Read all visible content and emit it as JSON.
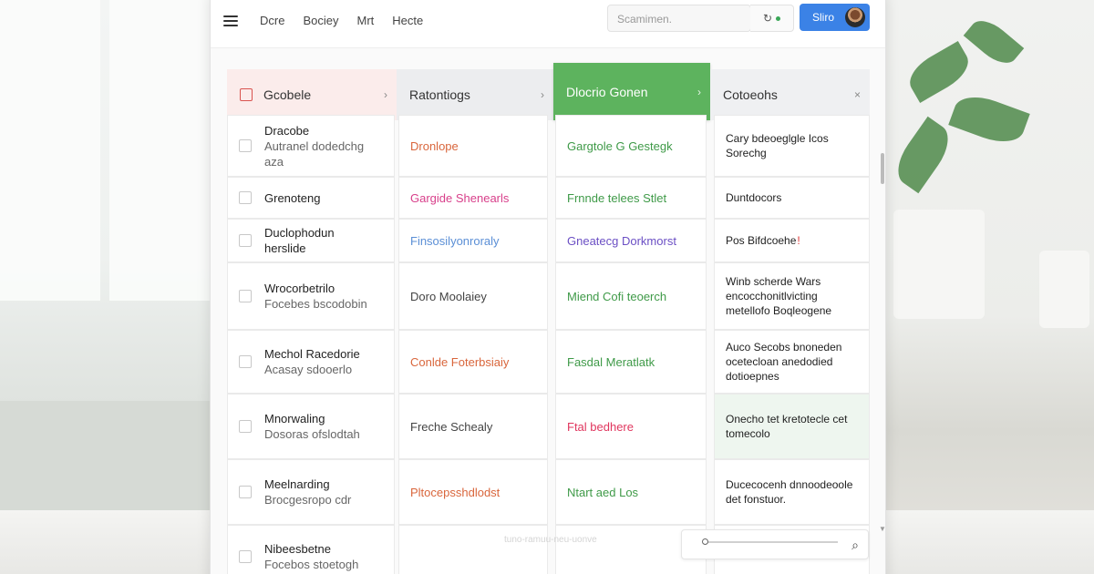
{
  "nav": {
    "items": [
      "Dcre",
      "Bociey",
      "Mrt",
      "Hecte"
    ]
  },
  "search": {
    "placeholder": "Scamimen."
  },
  "profile": {
    "label": "Sliro"
  },
  "board": {
    "columns": [
      {
        "label": "Gcobele",
        "chevron": "›"
      },
      {
        "label": "Ratontiogs",
        "chevron": "›"
      },
      {
        "label": "Dlocrio Gonen",
        "chevron": "›"
      },
      {
        "label": "Cotoeohs",
        "chevron": "×"
      }
    ],
    "rows": [
      {
        "title": "Dracobe",
        "subtitle": "Autranel dodedchg aza",
        "c1": "Dronlope",
        "c2": "Gargtole G Gestegk",
        "c3": "Cary bdeoeglgle Icos Sorechg"
      },
      {
        "title": "Grenoteng",
        "subtitle": "",
        "c1": "Gargide Shenearls",
        "c2": "Frnnde telees Stlet",
        "c3": "Duntdocors"
      },
      {
        "title": "Duclophodun",
        "subtitle": "herslide",
        "c1": "Finsosilyonroraly",
        "c2": "Gneatecg Dorkmorst",
        "c3": "Pos Bifdcoehe"
      },
      {
        "title": "Wrocorbetrilo",
        "subtitle": "Focebes bscodobin",
        "c1": "Doro Moolaiey",
        "c2": "Miend Cofi teoerch",
        "c3": "Winb scherde Wars encocchonitlvicting metellofo Boqleogene"
      },
      {
        "title": "Mechol Racedorie",
        "subtitle": "Acasay sdooerlo",
        "c1": "Conlde Foterbsiaiy",
        "c2": "Fasdal Meratlatk",
        "c3": "Auco Secobs bnoneden ocetecloan anedodied dotioepnes"
      },
      {
        "title": "Mnorwaling",
        "subtitle": "Dosoras ofslodtah",
        "c1": "Freche Schealy",
        "c2": "Ftal bedhere",
        "c3": "Onecho tet kretotecle cet tomecolo"
      },
      {
        "title": "Meelnarding",
        "subtitle": "Brocgesropo cdr",
        "c1": "Pltocepsshdlodst",
        "c2": "Ntart aed Los",
        "c3": "Ducecocenh dnnoodeoole det fonstuor."
      },
      {
        "title": "Nibeesbetne",
        "subtitle": "Focebos stoetogh",
        "c1": "",
        "c2": "",
        "c3": ""
      }
    ]
  },
  "footer": {
    "hint": "tuno-ramuu-neu-uonve"
  },
  "colors": {
    "accent": "#3b82e6",
    "done_header": "#5db35e",
    "todo_header": "#fbeceb"
  }
}
